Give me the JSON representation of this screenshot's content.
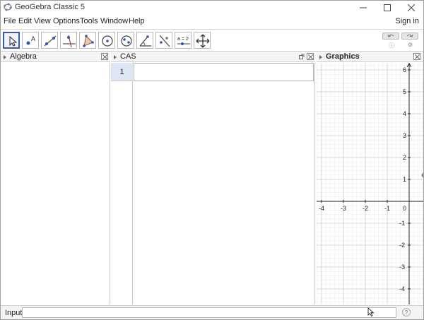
{
  "window": {
    "title": "GeoGebra Classic 5"
  },
  "menu": {
    "items": [
      "File",
      "Edit",
      "View",
      "Options",
      "Tools",
      "Window",
      "Help"
    ],
    "sign_in": "Sign in"
  },
  "toolbar": {
    "tools": [
      "move-tool",
      "point-tool",
      "line-tool",
      "perpendicular-line-tool",
      "polygon-tool",
      "circle-tool",
      "conic-tool",
      "angle-tool",
      "reflect-tool",
      "slider-tool",
      "move-graphics-view-tool"
    ],
    "slider_label": "a = 2",
    "selected_tool": "move-tool"
  },
  "panels": {
    "algebra": {
      "title": "Algebra"
    },
    "cas": {
      "title": "CAS",
      "rows": [
        {
          "number": "1",
          "input": ""
        }
      ]
    },
    "graphics": {
      "title": "Graphics",
      "x_ticks": [
        "-4",
        "-3",
        "-2",
        "-1",
        "0"
      ],
      "y_ticks": [
        "6",
        "5",
        "4",
        "3",
        "2",
        "1",
        "-1",
        "-2",
        "-3",
        "-4"
      ]
    }
  },
  "inputbar": {
    "label": "Input:",
    "value": "",
    "help": "?"
  }
}
